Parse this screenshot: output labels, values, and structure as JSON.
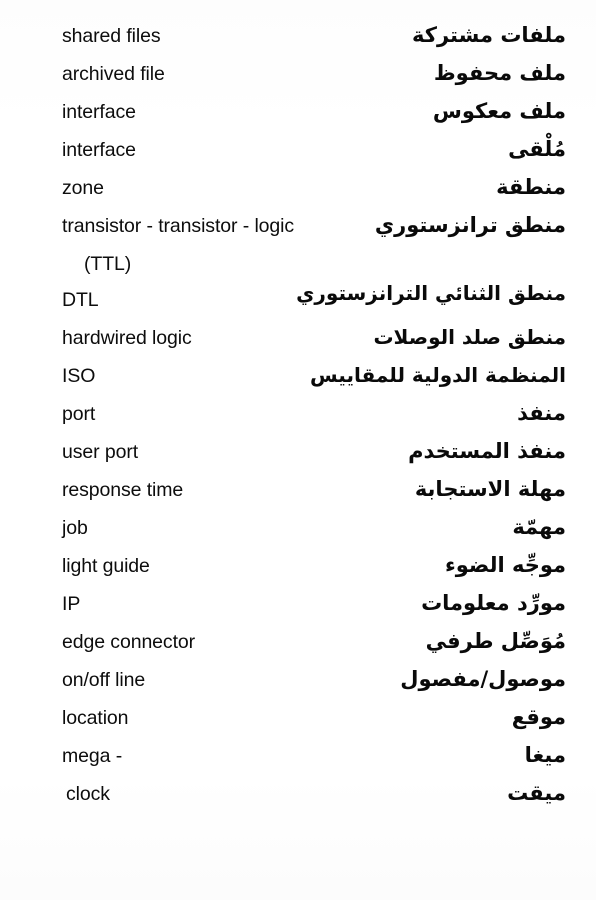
{
  "page": {
    "type": "bilingual-glossary",
    "direction_left": "ltr",
    "direction_right": "rtl",
    "left_language": "English",
    "right_language": "Arabic",
    "background_color": "#ffffff",
    "text_color": "#0a0a0a"
  },
  "entries": [
    {
      "term": "shared files",
      "gloss": "ملفات مشتركة"
    },
    {
      "term": "archived file",
      "gloss": "ملف محفوظ"
    },
    {
      "term": "interface",
      "gloss": "ملف معكوس"
    },
    {
      "term": "interface",
      "gloss": "مُلْقى"
    },
    {
      "term": "zone",
      "gloss": "منطقة"
    },
    {
      "term": "transistor - transistor - logic",
      "gloss": "منطق ترانزستوري"
    },
    {
      "term": "(TTL)",
      "gloss": ""
    },
    {
      "term": "DTL",
      "gloss": "منطق الثنائي الترانزستوري"
    },
    {
      "term": "hardwired logic",
      "gloss": "منطق صلد الوصلات"
    },
    {
      "term": "ISO",
      "gloss": "المنظمة الدولية للمقاييس"
    },
    {
      "term": "port",
      "gloss": "منفذ"
    },
    {
      "term": "user port",
      "gloss": "منفذ المستخدم"
    },
    {
      "term": "response time",
      "gloss": "مهلة الاستجابة"
    },
    {
      "term": "job",
      "gloss": "مهمّة"
    },
    {
      "term": "light guide",
      "gloss": "موجِّه الضوء"
    },
    {
      "term": "IP",
      "gloss": "مورِّد معلومات"
    },
    {
      "term": "edge connector",
      "gloss": "مُوَصِّل طرفي"
    },
    {
      "term": "on/off line",
      "gloss": "موصول/مفصول"
    },
    {
      "term": "location",
      "gloss": "موقع"
    },
    {
      "term": "mega -",
      "gloss": "ميغا"
    },
    {
      "term": "clock",
      "gloss": "ميقت"
    }
  ]
}
